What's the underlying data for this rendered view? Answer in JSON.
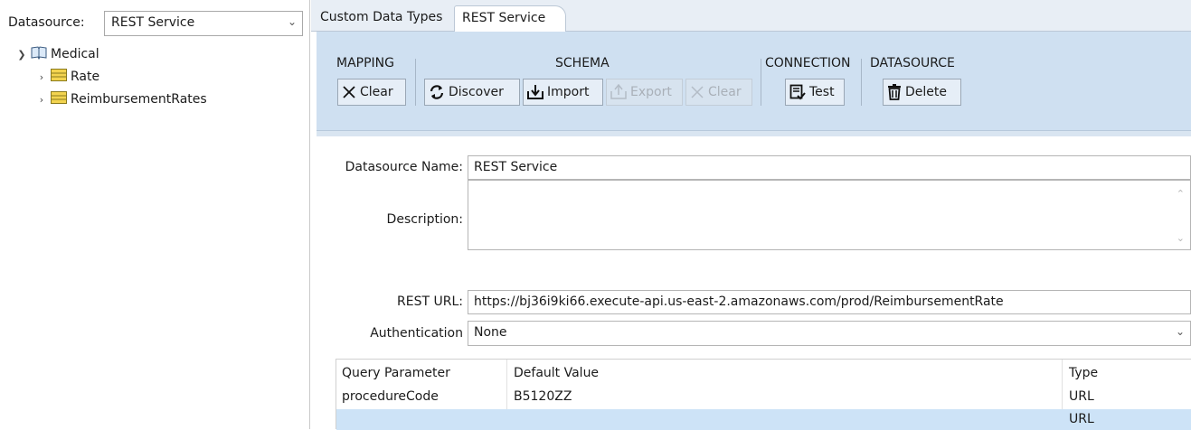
{
  "left_panel": {
    "datasource_label": "Datasource:",
    "datasource_value": "REST Service",
    "tree": [
      {
        "label": "Medical",
        "icon": "book-icon",
        "expanded": true
      },
      {
        "label": "Rate",
        "icon": "table-icon",
        "expanded": false
      },
      {
        "label": "ReimbursementRates",
        "icon": "table-icon",
        "expanded": false
      }
    ]
  },
  "tabs": {
    "custom_data_types": "Custom Data Types",
    "rest_service": "REST Service"
  },
  "toolbar": {
    "mapping_label": "MAPPING",
    "schema_label": "SCHEMA",
    "connection_label": "CONNECTION",
    "datasource_label": "DATASOURCE",
    "mapping_clear": "Clear",
    "discover": "Discover",
    "import": "Import",
    "export": "Export",
    "schema_clear": "Clear",
    "test": "Test",
    "delete": "Delete"
  },
  "form": {
    "name_label": "Datasource Name:",
    "name_value": "REST Service",
    "description_label": "Description:",
    "description_value": "",
    "url_label": "REST URL:",
    "url_value": "https://bj36i9ki66.execute-api.us-east-2.amazonaws.com/prod/ReimbursementRate",
    "auth_label": "Authentication",
    "auth_value": "None"
  },
  "params_table": {
    "headers": [
      "Query Parameter",
      "Default Value",
      "Type"
    ],
    "rows": [
      [
        "procedureCode",
        "B5120ZZ",
        "URL"
      ],
      [
        "",
        "",
        "URL"
      ]
    ]
  },
  "colors": {
    "toolbar_bg": "#cfe0f1",
    "selection": "#cde3f7",
    "table_icon": "#f3d44f"
  }
}
